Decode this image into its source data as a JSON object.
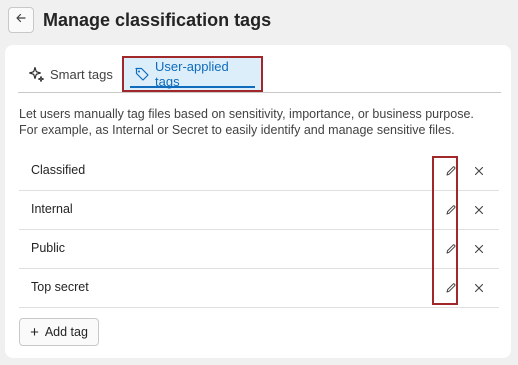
{
  "header": {
    "title": "Manage classification tags",
    "back_icon": "arrow-left-icon"
  },
  "tabs": [
    {
      "label": "Smart tags",
      "icon": "sparkle-icon",
      "selected": false
    },
    {
      "label": "User-applied tags",
      "icon": "tag-icon",
      "selected": true
    }
  ],
  "description": "Let users manually tag files based on sensitivity, importance, or business purpose. For example, as Internal or Secret to easily identify and manage sensitive files.",
  "tags": [
    {
      "name": "Classified"
    },
    {
      "name": "Internal"
    },
    {
      "name": "Public"
    },
    {
      "name": "Top secret"
    }
  ],
  "add_button": {
    "label": "Add tag",
    "icon": "plus-icon"
  },
  "colors": {
    "accent": "#0f6cbd",
    "highlight_border": "#a0282a",
    "selected_tab_bg": "#dceef9"
  }
}
